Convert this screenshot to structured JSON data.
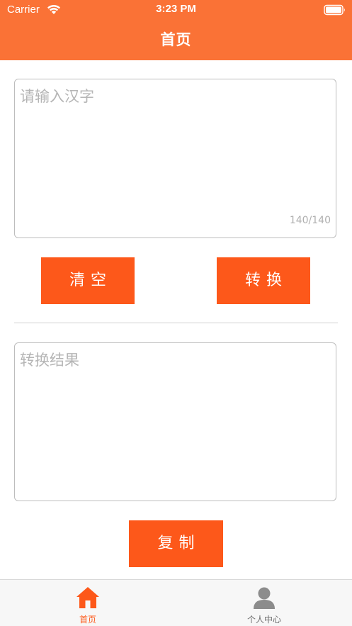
{
  "status_bar": {
    "carrier": "Carrier",
    "time": "3:23 PM"
  },
  "nav": {
    "title": "首页"
  },
  "input": {
    "placeholder": "请输入汉字",
    "counter": "140/140"
  },
  "buttons": {
    "clear_label": "清空",
    "convert_label": "转换",
    "copy_label": "复制"
  },
  "result": {
    "placeholder": "转换结果"
  },
  "tab_bar": {
    "tabs": [
      {
        "label": "首页",
        "icon": "home-icon",
        "active": true
      },
      {
        "label": "个人中心",
        "icon": "person-icon",
        "active": false
      }
    ]
  },
  "colors": {
    "header": "#FA7236",
    "button": "#FD581A",
    "active_tab": "#FD581A",
    "inactive_tab": "#6E6E6E"
  }
}
